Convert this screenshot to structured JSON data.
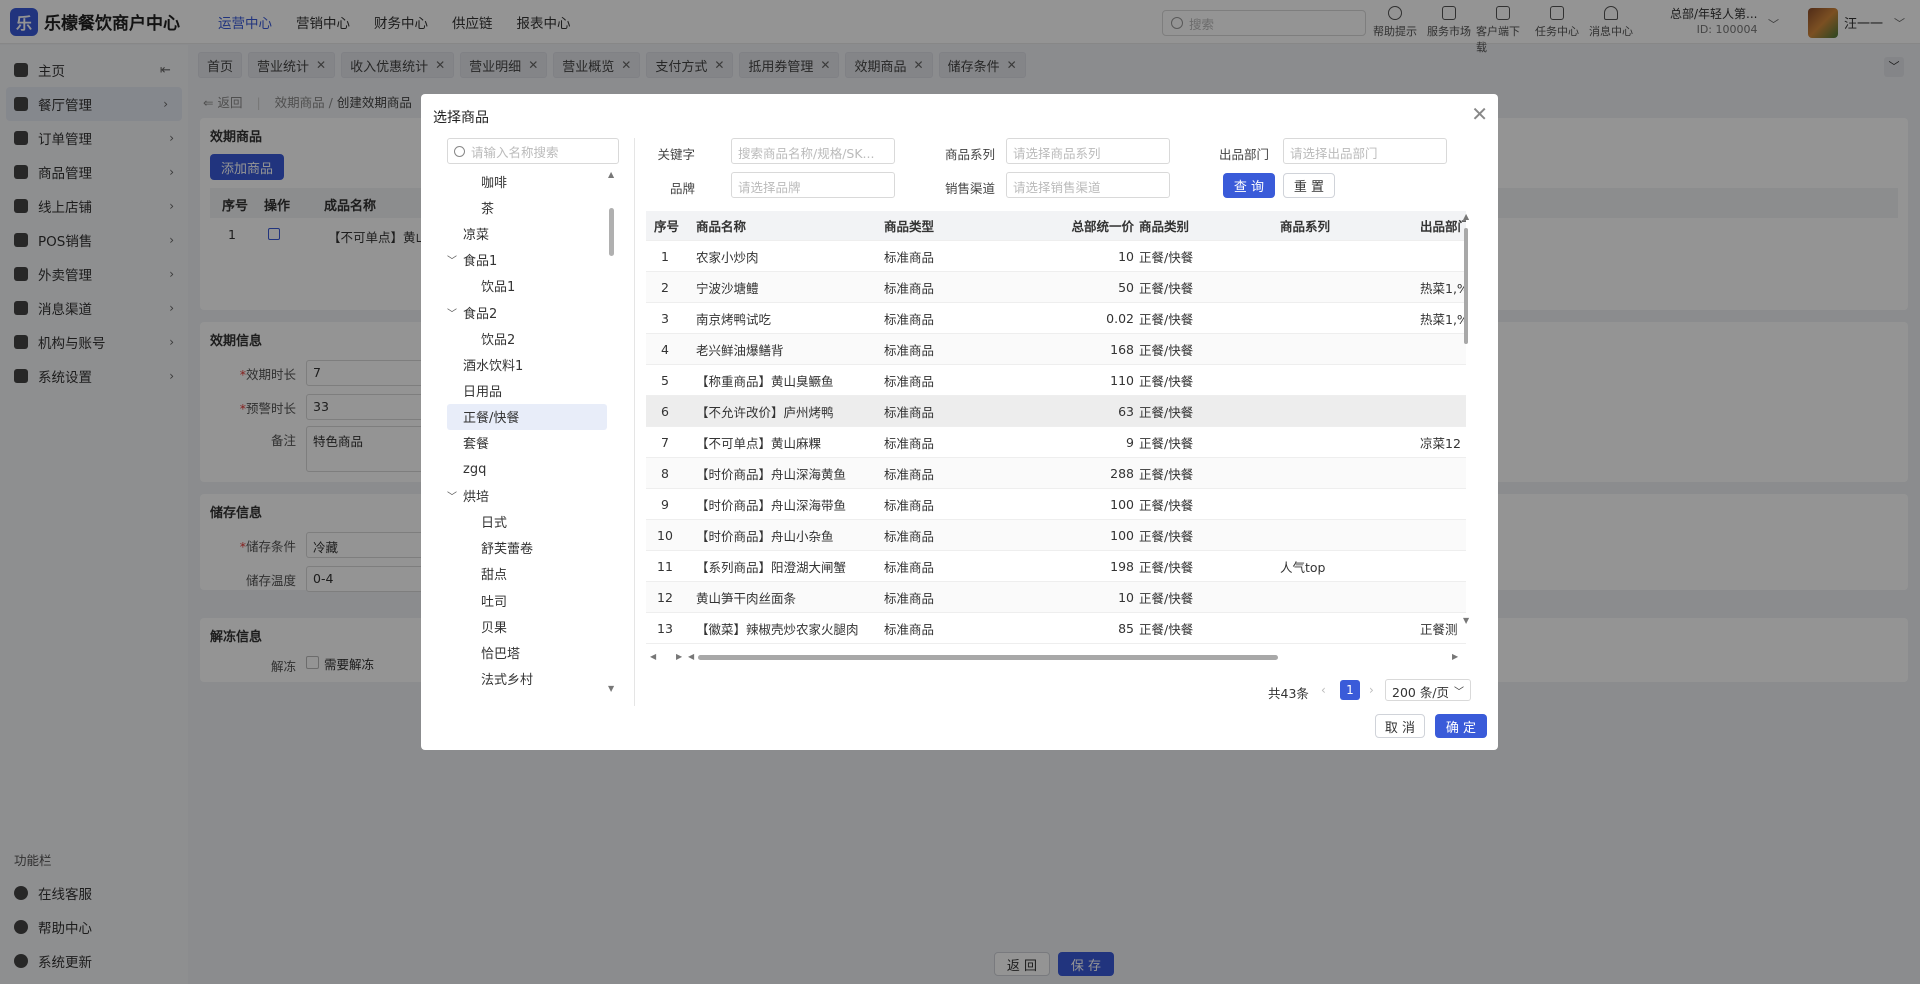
{
  "app": {
    "logo_glyph": "乐",
    "name": "乐檬餐饮商户中心"
  },
  "top_nav": [
    "运营中心",
    "营销中心",
    "财务中心",
    "供应链",
    "报表中心"
  ],
  "top_search_placeholder": "搜索",
  "tools": [
    "帮助提示",
    "服务市场",
    "客户端下载",
    "任务中心",
    "消息中心"
  ],
  "store": {
    "name": "总部/年轻人第...",
    "id": "ID: 100004"
  },
  "user": {
    "name": "汪一一"
  },
  "sidebar": {
    "items": [
      {
        "label": "主页",
        "icon": "home-icon"
      },
      {
        "label": "餐厅管理",
        "icon": "restaurant-icon"
      },
      {
        "label": "订单管理",
        "icon": "order-icon"
      },
      {
        "label": "商品管理",
        "icon": "goods-icon"
      },
      {
        "label": "线上店铺",
        "icon": "online-store-icon"
      },
      {
        "label": "POS销售",
        "icon": "pos-icon"
      },
      {
        "label": "外卖管理",
        "icon": "delivery-icon"
      },
      {
        "label": "消息渠道",
        "icon": "message-icon"
      },
      {
        "label": "机构与账号",
        "icon": "org-icon"
      },
      {
        "label": "系统设置",
        "icon": "gear-icon"
      }
    ],
    "section_title": "功能栏",
    "bottom": [
      "在线客服",
      "帮助中心",
      "系统更新"
    ]
  },
  "tabs": [
    "首页",
    "营业统计",
    "收入优惠统计",
    "营业明细",
    "营业概览",
    "支付方式",
    "抵用券管理",
    "效期商品",
    "储存条件"
  ],
  "breadcrumb": {
    "back": "返回",
    "parent": "效期商品",
    "current": "创建效期商品"
  },
  "page": {
    "goods_section": "效期商品",
    "add_button": "添加商品",
    "table_headers": [
      "序号",
      "操作",
      "成品名称"
    ],
    "row_index": "1",
    "row_name": "【不可单点】黄山",
    "validity_section": "效期信息",
    "validity_label": "效期时长",
    "validity_value": "7",
    "warning_label": "预警时长",
    "warning_value": "33",
    "remark_label": "备注",
    "remark_value": "特色商品",
    "storage_section": "储存信息",
    "storage_label": "储存条件",
    "storage_value": "冷藏",
    "temp_label": "储存温度",
    "temp_value": "0-4",
    "thaw_section": "解冻信息",
    "thaw_label": "解冻",
    "thaw_checkbox": "需要解冻",
    "back_button": "返 回",
    "save_button": "保 存"
  },
  "modal": {
    "title": "选择商品",
    "tree_search_placeholder": "请输入名称搜索",
    "tree": [
      {
        "label": "咖啡",
        "level": 2
      },
      {
        "label": "茶",
        "level": 2
      },
      {
        "label": "凉菜",
        "level": 1
      },
      {
        "label": "食品1",
        "level": 1,
        "expanded": true
      },
      {
        "label": "饮品1",
        "level": 2
      },
      {
        "label": "食品2",
        "level": 1,
        "expanded": true
      },
      {
        "label": "饮品2",
        "level": 2
      },
      {
        "label": "酒水饮料1",
        "level": 1
      },
      {
        "label": "日用品",
        "level": 1
      },
      {
        "label": "正餐/快餐",
        "level": 1,
        "selected": true
      },
      {
        "label": "套餐",
        "level": 1
      },
      {
        "label": "zgq",
        "level": 1
      },
      {
        "label": "烘培",
        "level": 1,
        "expanded": true
      },
      {
        "label": "日式",
        "level": 2
      },
      {
        "label": "舒芙蕾卷",
        "level": 2
      },
      {
        "label": "甜点",
        "level": 2
      },
      {
        "label": "吐司",
        "level": 2
      },
      {
        "label": "贝果",
        "level": 2
      },
      {
        "label": "恰巴塔",
        "level": 2
      },
      {
        "label": "法式乡村",
        "level": 2
      }
    ],
    "filters": {
      "keyword_label": "关键字",
      "keyword_placeholder": "搜索商品名称/规格/SK...",
      "series_label": "商品系列",
      "series_placeholder": "请选择商品系列",
      "dept_label": "出品部门",
      "dept_placeholder": "请选择出品部门",
      "brand_label": "品牌",
      "brand_placeholder": "请选择品牌",
      "channel_label": "销售渠道",
      "channel_placeholder": "请选择销售渠道",
      "query_button": "查 询",
      "reset_button": "重 置"
    },
    "columns": [
      "序号",
      "商品名称",
      "商品类型",
      "总部统一价",
      "商品类别",
      "商品系列",
      "出品部门"
    ],
    "rows": [
      {
        "idx": "1",
        "name": "农家小炒肉",
        "type": "标准商品",
        "price": "10",
        "category": "正餐/快餐",
        "series": "",
        "dept": ""
      },
      {
        "idx": "2",
        "name": "宁波沙塘鳢",
        "type": "标准商品",
        "price": "50",
        "category": "正餐/快餐",
        "series": "",
        "dept": "热菜1,%"
      },
      {
        "idx": "3",
        "name": "南京烤鸭试吃",
        "type": "标准商品",
        "price": "0.02",
        "category": "正餐/快餐",
        "series": "",
        "dept": "热菜1,%"
      },
      {
        "idx": "4",
        "name": "老兴鲜油爆鳝背",
        "type": "标准商品",
        "price": "168",
        "category": "正餐/快餐",
        "series": "",
        "dept": ""
      },
      {
        "idx": "5",
        "name": "【称重商品】黄山臭鳜鱼",
        "type": "标准商品",
        "price": "110",
        "category": "正餐/快餐",
        "series": "",
        "dept": ""
      },
      {
        "idx": "6",
        "name": "【不允许改价】庐州烤鸭",
        "type": "标准商品",
        "price": "63",
        "category": "正餐/快餐",
        "series": "",
        "dept": ""
      },
      {
        "idx": "7",
        "name": "【不可单点】黄山麻粿",
        "type": "标准商品",
        "price": "9",
        "category": "正餐/快餐",
        "series": "",
        "dept": "凉菜12"
      },
      {
        "idx": "8",
        "name": "【时价商品】舟山深海黄鱼",
        "type": "标准商品",
        "price": "288",
        "category": "正餐/快餐",
        "series": "",
        "dept": ""
      },
      {
        "idx": "9",
        "name": "【时价商品】舟山深海带鱼",
        "type": "标准商品",
        "price": "100",
        "category": "正餐/快餐",
        "series": "",
        "dept": ""
      },
      {
        "idx": "10",
        "name": "【时价商品】舟山小杂鱼",
        "type": "标准商品",
        "price": "100",
        "category": "正餐/快餐",
        "series": "",
        "dept": ""
      },
      {
        "idx": "11",
        "name": "【系列商品】阳澄湖大闸蟹",
        "type": "标准商品",
        "price": "198",
        "category": "正餐/快餐",
        "series": "人气top",
        "dept": ""
      },
      {
        "idx": "12",
        "name": "黄山笋干肉丝面条",
        "type": "标准商品",
        "price": "10",
        "category": "正餐/快餐",
        "series": "",
        "dept": ""
      },
      {
        "idx": "13",
        "name": "【徽菜】辣椒壳炒农家火腿肉",
        "type": "标准商品",
        "price": "85",
        "category": "正餐/快餐",
        "series": "",
        "dept": "正餐测"
      }
    ],
    "pager": {
      "total": "共43条",
      "page": "1",
      "page_size": "200 条/页"
    },
    "cancel_button": "取 消",
    "confirm_button": "确 定"
  }
}
